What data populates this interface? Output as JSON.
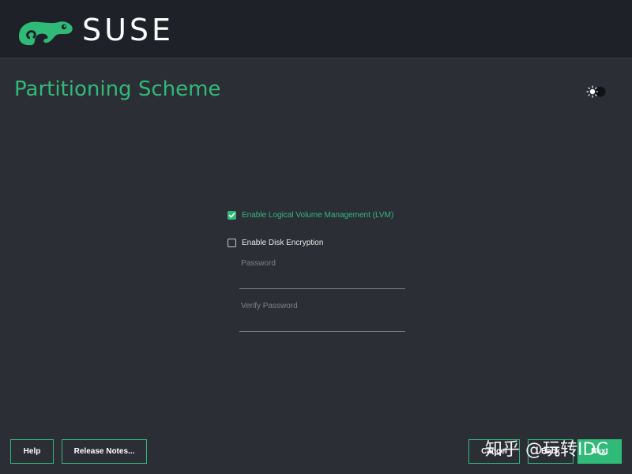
{
  "brand": {
    "name": "SUSE",
    "logo_icon": "chameleon-logo-icon",
    "accent_color": "#30ba78"
  },
  "page": {
    "title": "Partitioning Scheme",
    "theme_toggle_icon": "sun-moon-icon"
  },
  "form": {
    "lvm": {
      "label": "Enable Logical Volume Management (LVM)",
      "checked": true
    },
    "encryption": {
      "label": "Enable Disk Encryption",
      "checked": false
    },
    "password": {
      "label": "Password",
      "value": ""
    },
    "verify_password": {
      "label": "Verify Password",
      "value": ""
    }
  },
  "buttons": {
    "help": "Help",
    "release_notes": "Release Notes...",
    "cancel": "Cancel",
    "back": "Back",
    "next": "Next"
  },
  "watermark": "知乎 @玩转IDC"
}
